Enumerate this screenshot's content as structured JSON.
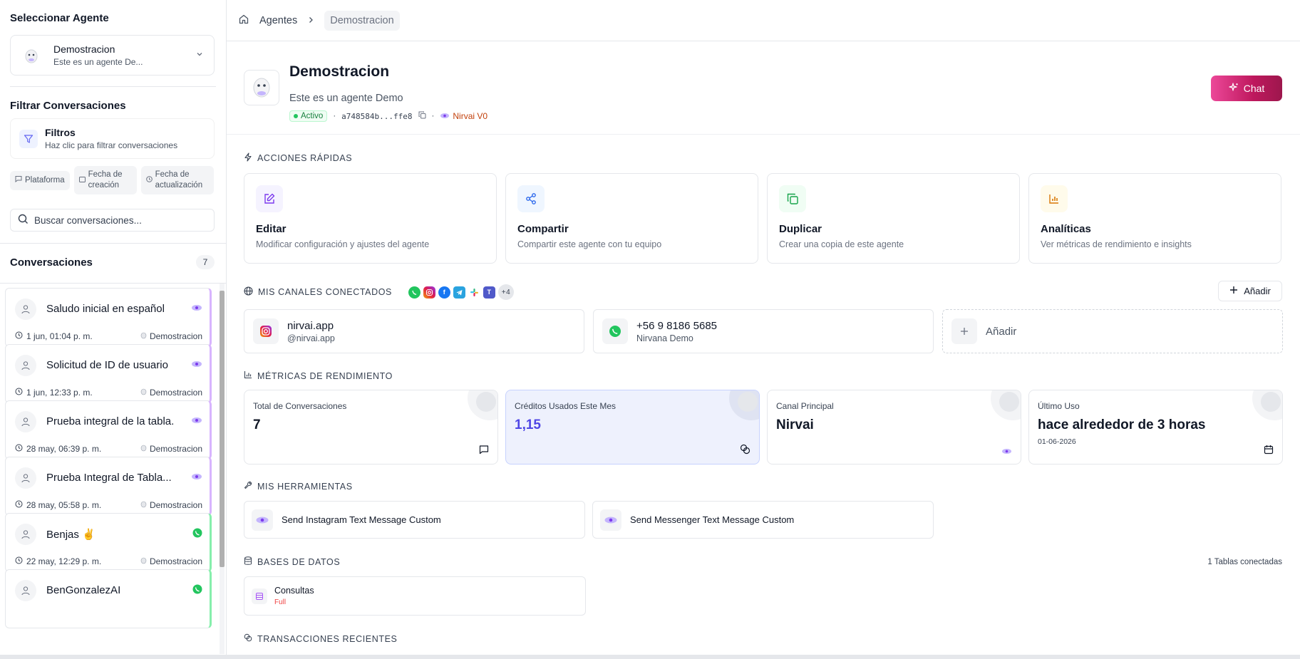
{
  "sidebar": {
    "select_agent_title": "Seleccionar Agente",
    "agent": {
      "name": "Demostracion",
      "description": "Este es un agente De..."
    },
    "filter_title": "Filtrar Conversaciones",
    "filters": {
      "title": "Filtros",
      "hint": "Haz clic para filtrar conversaciones"
    },
    "chips": [
      {
        "label": "Plataforma"
      },
      {
        "label": "Fecha de creación"
      },
      {
        "label": "Fecha de actualización"
      }
    ],
    "search_placeholder": "Buscar conversaciones...",
    "conversations_title": "Conversaciones",
    "conversations_count": "7",
    "conversations": [
      {
        "title": "Saludo inicial en español",
        "date": "1 jun, 01:04 p. m.",
        "agent": "Demostracion",
        "platform": "nirvai"
      },
      {
        "title": "Solicitud de ID de usuario",
        "date": "1 jun, 12:33 p. m.",
        "agent": "Demostracion",
        "platform": "nirvai"
      },
      {
        "title": "Prueba integral de la tabla...",
        "date": "28 may, 06:39 p. m.",
        "agent": "Demostracion",
        "platform": "nirvai"
      },
      {
        "title": "Prueba Integral de Tabla...",
        "date": "28 may, 05:58 p. m.",
        "agent": "Demostracion",
        "platform": "nirvai"
      },
      {
        "title": "Benjas ✌️",
        "date": "22 may, 12:29 p. m.",
        "agent": "Demostracion",
        "platform": "whatsapp"
      },
      {
        "title": "BenGonzalezAI",
        "date": "",
        "agent": "",
        "platform": "whatsapp"
      }
    ]
  },
  "breadcrumb": {
    "parent": "Agentes",
    "current": "Demostracion"
  },
  "agent": {
    "name": "Demostracion",
    "description": "Este es un agente Demo",
    "status": "Activo",
    "id_short": "a748584b...ffe8",
    "model": "Nirvai V0",
    "chat_label": "Chat"
  },
  "quick_actions": {
    "title": "ACCIONES RÁPIDAS",
    "items": [
      {
        "name": "Editar",
        "description": "Modificar configuración y ajustes del agente"
      },
      {
        "name": "Compartir",
        "description": "Compartir este agente con tu equipo"
      },
      {
        "name": "Duplicar",
        "description": "Crear una copia de este agente"
      },
      {
        "name": "Analíticas",
        "description": "Ver métricas de rendimiento e insights"
      }
    ]
  },
  "channels": {
    "title": "MIS CANALES CONECTADOS",
    "more": "+4",
    "add_label": "Añadir",
    "items": [
      {
        "name": "nirvai.app",
        "handle": "@nirvai.app",
        "type": "instagram"
      },
      {
        "name": "+56 9 8186 5685",
        "handle": "Nirvana Demo",
        "type": "whatsapp"
      }
    ],
    "add_card_label": "Añadir"
  },
  "metrics": {
    "title": "MÉTRICAS DE RENDIMIENTO",
    "items": [
      {
        "label": "Total de Conversaciones",
        "value": "7",
        "sub": ""
      },
      {
        "label": "Créditos Usados Este Mes",
        "value": "1,15",
        "sub": ""
      },
      {
        "label": "Canal Principal",
        "value": "Nirvai",
        "sub": ""
      },
      {
        "label": "Último Uso",
        "value": "hace alrededor de 3 horas",
        "sub": "01-06-2026"
      }
    ]
  },
  "tools": {
    "title": "MIS HERRAMIENTAS",
    "items": [
      {
        "name": "Send Instagram Text Message Custom"
      },
      {
        "name": "Send Messenger Text Message Custom"
      }
    ]
  },
  "databases": {
    "title": "BASES DE DATOS",
    "count_label": "1 Tablas conectadas",
    "items": [
      {
        "name": "Consultas",
        "access": "Full"
      }
    ]
  },
  "transactions": {
    "title": "TRANSACCIONES RECIENTES"
  },
  "colors": {
    "accent": "#6366f1",
    "chat_gradient_start": "#ec4899",
    "chat_gradient_end": "#9d174d",
    "active_green": "#15803d",
    "model_orange": "#c2410c"
  }
}
